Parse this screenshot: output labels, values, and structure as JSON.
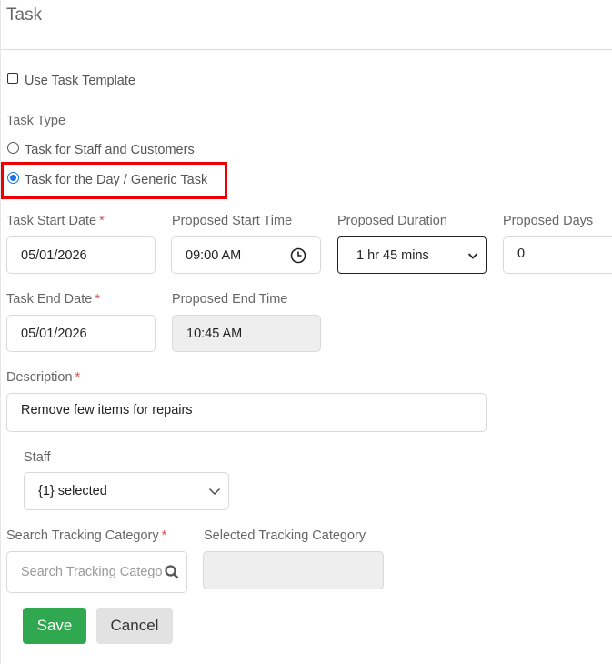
{
  "header": {
    "title": "Task"
  },
  "template": {
    "label": "Use Task Template"
  },
  "task_type": {
    "label": "Task Type",
    "options": [
      "Task for Staff and Customers",
      "Task for the Day / Generic Task"
    ],
    "selected_index": 1
  },
  "fields": {
    "start_date": {
      "label": "Task Start Date",
      "value": "05/01/2026"
    },
    "start_time": {
      "label": "Proposed Start Time",
      "value": "09:00 AM"
    },
    "duration": {
      "label": "Proposed Duration",
      "value": "1 hr 45 mins"
    },
    "days": {
      "label": "Proposed Days",
      "value": "0"
    },
    "end_date": {
      "label": "Task End Date",
      "value": "05/01/2026"
    },
    "end_time": {
      "label": "Proposed End Time",
      "value": "10:45 AM"
    },
    "description": {
      "label": "Description",
      "value": "Remove few items for repairs"
    },
    "staff": {
      "label": "Staff",
      "value": "{1} selected"
    },
    "tracking_search": {
      "label": "Search Tracking Category",
      "placeholder": "Search Tracking Catego"
    },
    "tracking_selected": {
      "label": "Selected Tracking Category",
      "value": ""
    }
  },
  "required_marker": "*",
  "buttons": {
    "save": "Save",
    "cancel": "Cancel"
  },
  "colors": {
    "highlight": "#ee0000",
    "save": "#2fa84f",
    "radio_selected": "#1a73e8",
    "required": "#d9534f"
  },
  "icons": [
    "clock-icon",
    "chevron-down-icon",
    "search-icon"
  ]
}
